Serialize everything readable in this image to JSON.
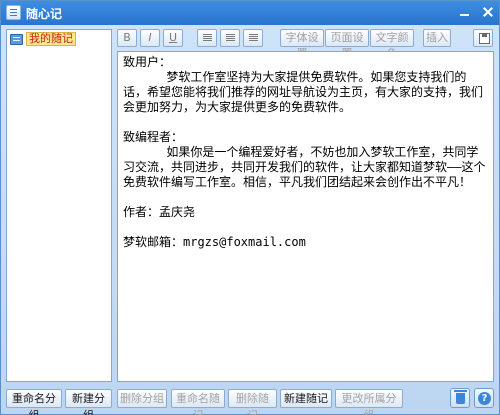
{
  "window": {
    "title": "随心记"
  },
  "tree": {
    "items": [
      {
        "label": "我的随记"
      }
    ]
  },
  "toolbar": {
    "bold": "B",
    "italic": "I",
    "underline": "U",
    "font_settings": "字体设置",
    "page_settings": "页面设置",
    "text_color": "文字颜色",
    "insert": "插入"
  },
  "editor": {
    "lines": [
      "致用户：",
      "      梦软工作室坚持为大家提供免费软件。如果您支持我们的话，希望您能将我们推荐的网址导航设为主页，有大家的支持，我们会更加努力，为大家提供更多的免费软件。",
      "",
      "致编程者：",
      "      如果你是一个编程爱好者，不妨也加入梦软工作室，共同学习交流，共同进步，共同开发我们的软件，让大家都知道梦软——这个免费软件编写工作室。相信，平凡我们团结起来会创作出不平凡！",
      "",
      "作者：孟庆尧",
      "",
      "梦软邮箱：mrgzs@foxmail.com"
    ]
  },
  "bottom": {
    "rename_group": "重命名分组",
    "new_group": "新建分组",
    "delete_group": "删除分组",
    "rename_note": "重命名随记",
    "delete_note": "删除随记",
    "new_note": "新建随记",
    "change_group": "更改所属分组",
    "help_glyph": "?"
  }
}
